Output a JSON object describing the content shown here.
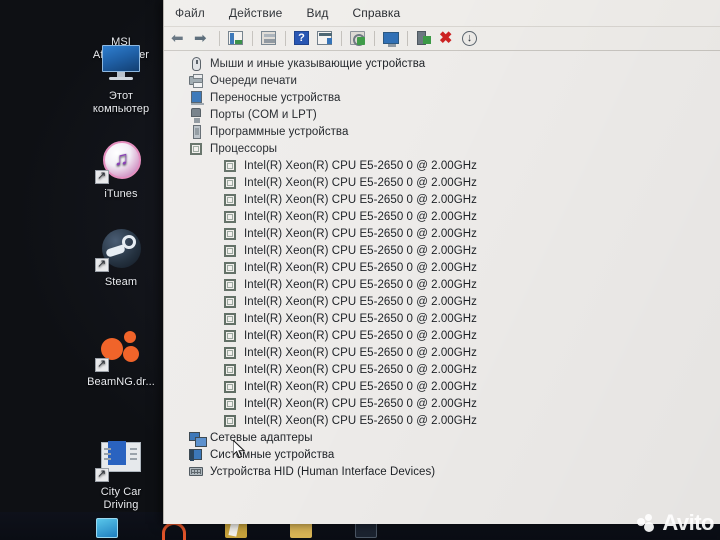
{
  "desktop": {
    "icons": [
      {
        "name": "msi-afterburner",
        "label_line1": "MSI",
        "label_line2": "Afterburner",
        "icon": "msi-afterburner-icon"
      },
      {
        "name": "this-pc",
        "label_line1": "Этот",
        "label_line2": "компьютер",
        "icon": "monitor-icon"
      },
      {
        "name": "itunes",
        "label_line1": "iTunes",
        "label_line2": "",
        "icon": "itunes-icon"
      },
      {
        "name": "steam",
        "label_line1": "Steam",
        "label_line2": "",
        "icon": "steam-icon"
      },
      {
        "name": "beamng-drive",
        "label_line1": "BeamNG.dr...",
        "label_line2": "",
        "icon": "beamng-icon"
      },
      {
        "name": "city-car-driving",
        "label_line1": "City Car",
        "label_line2": "Driving",
        "icon": "city-car-driving-icon"
      }
    ]
  },
  "window": {
    "menubar": [
      {
        "name": "file",
        "label": "Файл"
      },
      {
        "name": "action",
        "label": "Действие"
      },
      {
        "name": "view",
        "label": "Вид"
      },
      {
        "name": "help",
        "label": "Справка"
      }
    ],
    "toolbar": [
      {
        "name": "back-button",
        "icon": "arrow-left-icon",
        "glyph": "←"
      },
      {
        "name": "forward-button",
        "icon": "arrow-right-icon",
        "glyph": "→"
      },
      {
        "name": "properties-button",
        "icon": "properties-icon"
      },
      {
        "name": "show-hide-console-tree-button",
        "icon": "window-panel-icon"
      },
      {
        "name": "help-button",
        "icon": "question-mark-icon",
        "glyph": "?"
      },
      {
        "name": "device-list-button",
        "icon": "device-list-icon"
      },
      {
        "name": "update-driver-button",
        "icon": "scan-gear-icon"
      },
      {
        "name": "show-hidden-devices-button",
        "icon": "monitor-icon"
      },
      {
        "name": "enable-device-button",
        "icon": "device-enable-icon"
      },
      {
        "name": "uninstall-device-button",
        "icon": "red-x-icon",
        "glyph": "✖"
      },
      {
        "name": "scan-hardware-changes-button",
        "icon": "circle-down-arrow-icon",
        "glyph": "↓"
      }
    ],
    "tree": {
      "items": [
        {
          "name": "mice-and-pointing-devices",
          "label": "Мыши и иные указывающие устройства",
          "icon": "mouse-icon",
          "state": "collapsed",
          "chevron": "›"
        },
        {
          "name": "print-queues",
          "label": "Очереди печати",
          "icon": "printer-icon",
          "state": "collapsed",
          "chevron": "›"
        },
        {
          "name": "portable-devices",
          "label": "Переносные устройства",
          "icon": "portable-device-icon",
          "state": "collapsed",
          "chevron": "›"
        },
        {
          "name": "ports-com-lpt",
          "label": "Порты (COM и LPT)",
          "icon": "port-icon",
          "state": "collapsed",
          "chevron": "›"
        },
        {
          "name": "software-devices",
          "label": "Программные устройства",
          "icon": "software-device-icon",
          "state": "collapsed",
          "chevron": "›"
        },
        {
          "name": "processors",
          "label": "Процессоры",
          "icon": "processor-icon",
          "state": "expanded",
          "chevron": "⌄"
        }
      ],
      "processor_label": "Intel(R) Xeon(R) CPU E5-2650 0 @ 2.00GHz",
      "processor_count": 16,
      "processor_icon": "processor-icon",
      "tail_items": [
        {
          "name": "network-adapters",
          "label": "Сетевые адаптеры",
          "icon": "network-adapter-icon",
          "state": "collapsed",
          "chevron": "›"
        },
        {
          "name": "system-devices",
          "label": "Системные устройства",
          "icon": "system-device-icon",
          "state": "collapsed",
          "chevron": "›"
        },
        {
          "name": "hid-devices",
          "label": "Устройства HID (Human Interface Devices)",
          "icon": "hid-icon",
          "state": "collapsed",
          "chevron": "›"
        }
      ]
    }
  },
  "watermark": {
    "name": "avito-watermark",
    "text": "Avito",
    "icon": "avito-dots-icon"
  },
  "colors": {
    "window_bg": "#ebe9e5",
    "tree_bg": "#eeecea",
    "text": "#1d2126",
    "accent_blue": "#2f6fb5",
    "accent_red": "#cc2222",
    "accent_green": "#3c9a46",
    "desktop_bg": "#15161c"
  }
}
